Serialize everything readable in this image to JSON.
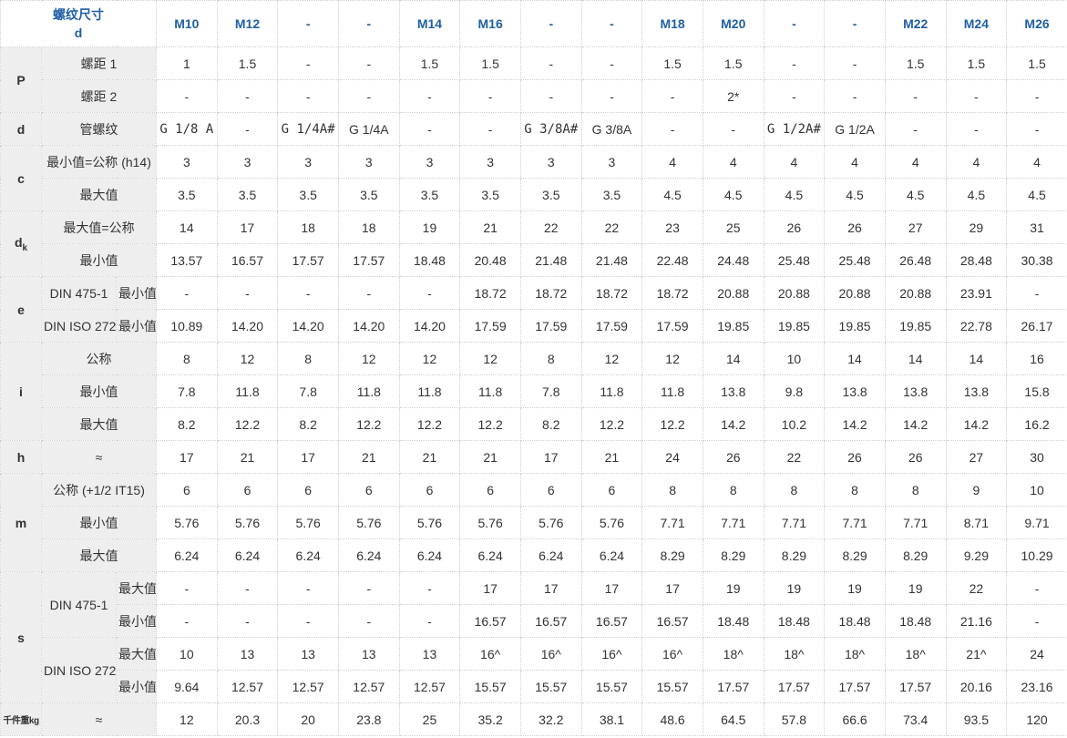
{
  "header": {
    "corner_title": "螺纹尺寸",
    "corner_sub": "d",
    "columns": [
      "M10",
      "M12",
      "-",
      "-",
      "M14",
      "M16",
      "-",
      "-",
      "M18",
      "M20",
      "-",
      "-",
      "M22",
      "M24",
      "M26"
    ]
  },
  "groups": {
    "P": "P",
    "d": "d",
    "c": "c",
    "dk_main": "d",
    "dk_sub": "k",
    "e": "e",
    "i": "i",
    "h": "h",
    "m": "m",
    "s": "s",
    "weight": "千件重kg"
  },
  "labels": {
    "pitch1": "螺距 1",
    "pitch2": "螺距 2",
    "pipe_thread": "管螺纹",
    "c_min": "最小值=公称 (h14)",
    "c_max": "最大值",
    "dk_max": "最大值=公称",
    "dk_min": "最小值",
    "e_din475": "DIN 475-1",
    "e_din475_min": "最小值",
    "e_diniso": "DIN ISO 272",
    "e_diniso_min": "最小值",
    "i_nom": "公称",
    "i_min": "最小值",
    "i_max": "最大值",
    "h_approx": "≈",
    "m_nom": "公称 (+1/2 IT15)",
    "m_min": "最小值",
    "m_max": "最大值",
    "s_din475": "DIN 475-1",
    "s_diniso": "DIN ISO 272",
    "s_max": "最大值",
    "s_min": "最小值",
    "weight_approx": "≈"
  },
  "rows": {
    "pitch1": [
      "1",
      "1.5",
      "-",
      "-",
      "1.5",
      "1.5",
      "-",
      "-",
      "1.5",
      "1.5",
      "-",
      "-",
      "1.5",
      "1.5",
      "1.5"
    ],
    "pitch2": [
      "-",
      "-",
      "-",
      "-",
      "-",
      "-",
      "-",
      "-",
      "-",
      "2*",
      "-",
      "-",
      "-",
      "-",
      "-"
    ],
    "pipe_thread": [
      "G 1/8 A",
      "-",
      "G 1/4A#",
      "G 1/4A",
      "-",
      "-",
      "G 3/8A#",
      "G 3/8A",
      "-",
      "-",
      "G 1/2A#",
      "G 1/2A",
      "-",
      "-",
      "-"
    ],
    "c_min": [
      "3",
      "3",
      "3",
      "3",
      "3",
      "3",
      "3",
      "3",
      "4",
      "4",
      "4",
      "4",
      "4",
      "4",
      "4"
    ],
    "c_max": [
      "3.5",
      "3.5",
      "3.5",
      "3.5",
      "3.5",
      "3.5",
      "3.5",
      "3.5",
      "4.5",
      "4.5",
      "4.5",
      "4.5",
      "4.5",
      "4.5",
      "4.5"
    ],
    "dk_max": [
      "14",
      "17",
      "18",
      "18",
      "19",
      "21",
      "22",
      "22",
      "23",
      "25",
      "26",
      "26",
      "27",
      "29",
      "31"
    ],
    "dk_min": [
      "13.57",
      "16.57",
      "17.57",
      "17.57",
      "18.48",
      "20.48",
      "21.48",
      "21.48",
      "22.48",
      "24.48",
      "25.48",
      "25.48",
      "26.48",
      "28.48",
      "30.38"
    ],
    "e_din475_min": [
      "-",
      "-",
      "-",
      "-",
      "-",
      "18.72",
      "18.72",
      "18.72",
      "18.72",
      "20.88",
      "20.88",
      "20.88",
      "20.88",
      "23.91",
      "-"
    ],
    "e_diniso_min": [
      "10.89",
      "14.20",
      "14.20",
      "14.20",
      "14.20",
      "17.59",
      "17.59",
      "17.59",
      "17.59",
      "19.85",
      "19.85",
      "19.85",
      "19.85",
      "22.78",
      "26.17"
    ],
    "i_nom": [
      "8",
      "12",
      "8",
      "12",
      "12",
      "12",
      "8",
      "12",
      "12",
      "14",
      "10",
      "14",
      "14",
      "14",
      "16"
    ],
    "i_min": [
      "7.8",
      "11.8",
      "7.8",
      "11.8",
      "11.8",
      "11.8",
      "7.8",
      "11.8",
      "11.8",
      "13.8",
      "9.8",
      "13.8",
      "13.8",
      "13.8",
      "15.8"
    ],
    "i_max": [
      "8.2",
      "12.2",
      "8.2",
      "12.2",
      "12.2",
      "12.2",
      "8.2",
      "12.2",
      "12.2",
      "14.2",
      "10.2",
      "14.2",
      "14.2",
      "14.2",
      "16.2"
    ],
    "h_approx": [
      "17",
      "21",
      "17",
      "21",
      "21",
      "21",
      "17",
      "21",
      "24",
      "26",
      "22",
      "26",
      "26",
      "27",
      "30"
    ],
    "m_nom": [
      "6",
      "6",
      "6",
      "6",
      "6",
      "6",
      "6",
      "6",
      "8",
      "8",
      "8",
      "8",
      "8",
      "9",
      "10"
    ],
    "m_min": [
      "5.76",
      "5.76",
      "5.76",
      "5.76",
      "5.76",
      "5.76",
      "5.76",
      "5.76",
      "7.71",
      "7.71",
      "7.71",
      "7.71",
      "7.71",
      "8.71",
      "9.71"
    ],
    "m_max": [
      "6.24",
      "6.24",
      "6.24",
      "6.24",
      "6.24",
      "6.24",
      "6.24",
      "6.24",
      "8.29",
      "8.29",
      "8.29",
      "8.29",
      "8.29",
      "9.29",
      "10.29"
    ],
    "s_din475_max": [
      "-",
      "-",
      "-",
      "-",
      "-",
      "17",
      "17",
      "17",
      "17",
      "19",
      "19",
      "19",
      "19",
      "22",
      "-"
    ],
    "s_din475_min": [
      "-",
      "-",
      "-",
      "-",
      "-",
      "16.57",
      "16.57",
      "16.57",
      "16.57",
      "18.48",
      "18.48",
      "18.48",
      "18.48",
      "21.16",
      "-"
    ],
    "s_diniso_max": [
      "10",
      "13",
      "13",
      "13",
      "13",
      "16^",
      "16^",
      "16^",
      "16^",
      "18^",
      "18^",
      "18^",
      "18^",
      "21^",
      "24"
    ],
    "s_diniso_min": [
      "9.64",
      "12.57",
      "12.57",
      "12.57",
      "12.57",
      "15.57",
      "15.57",
      "15.57",
      "15.57",
      "17.57",
      "17.57",
      "17.57",
      "17.57",
      "20.16",
      "23.16"
    ],
    "weight_approx": [
      "12",
      "20.3",
      "20",
      "23.8",
      "25",
      "35.2",
      "32.2",
      "38.1",
      "48.6",
      "64.5",
      "57.8",
      "66.6",
      "73.4",
      "93.5",
      "120"
    ]
  }
}
